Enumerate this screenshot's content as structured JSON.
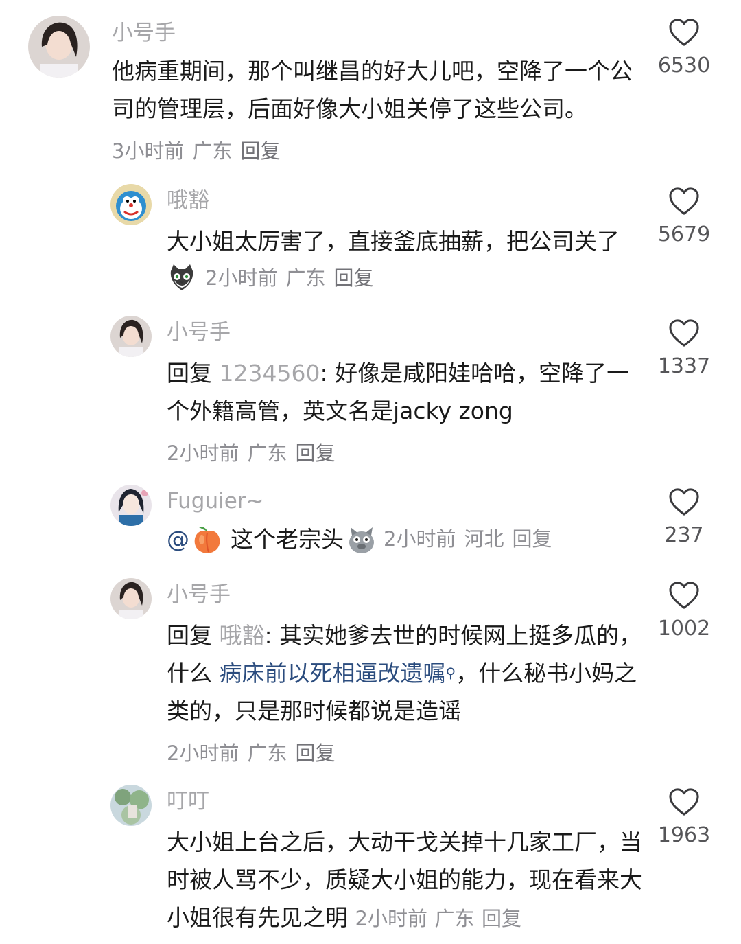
{
  "comments": [
    {
      "author": "小号手",
      "text": "他病重期间，那个叫继昌的好大儿吧，空降了一个公司的管理层，后面好像大小姐关停了这些公司。",
      "time": "3小时前",
      "location": "广东",
      "reply_label": "回复",
      "likes": "6530"
    },
    {
      "author": "哦豁",
      "text": "大小姐太厉害了，直接釜底抽薪，把公司关了",
      "time": "2小时前",
      "location": "广东",
      "reply_label": "回复",
      "likes": "5679",
      "meta_emoji": "cat-emoji"
    },
    {
      "author": "小号手",
      "reply_prefix": "回复",
      "reply_to": "1234560",
      "text": ": 好像是咸阳娃哈哈，空降了一个外籍高管，英文名是jacky zong",
      "time": "2小时前",
      "location": "广东",
      "reply_label": "回复",
      "likes": "1337"
    },
    {
      "author": "Fuguier~",
      "mention": "@",
      "text": "这个老宗头",
      "time": "2小时前",
      "location": "河北",
      "reply_label": "回复",
      "likes": "237",
      "emojis": [
        "peach-emoji",
        "doge-emoji"
      ]
    },
    {
      "author": "小号手",
      "reply_prefix": "回复",
      "reply_to": "哦豁",
      "text_before": ": 其实她爹去世的时候网上挺多瓜的，什么 ",
      "link": "病床前以死相逼改遗嘱",
      "text_after": "，什么秘书小妈之类的，只是那时候都说是造谣",
      "time": "2小时前",
      "location": "广东",
      "reply_label": "回复",
      "likes": "1002"
    },
    {
      "author": "叮叮",
      "text": "大小姐上台之后，大动干戈关掉十几家工厂，当时被人骂不少，质疑大小姐的能力，现在看来大小姐很有先见之明",
      "time": "2小时前",
      "location": "广东",
      "reply_label": "回复",
      "likes": "1963"
    }
  ],
  "colors": {
    "text": "#1a1a1a",
    "secondary": "#a6a6a9",
    "link": "#2b4c7e",
    "heart": "#3a3a3d"
  }
}
